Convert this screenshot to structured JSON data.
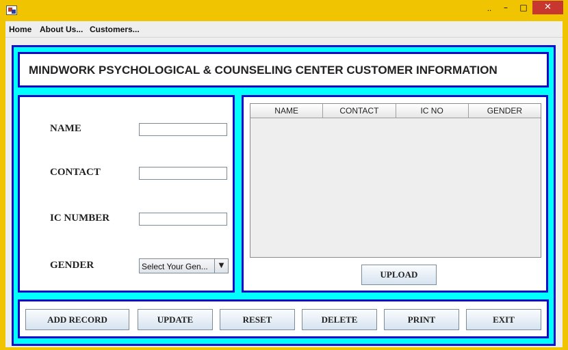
{
  "window": {
    "restore_glyph": "..",
    "minimize_glyph": "–",
    "maximize_glyph": "□",
    "close_glyph": "✕"
  },
  "menu": {
    "items": [
      {
        "label": "Home"
      },
      {
        "label": "About Us..."
      },
      {
        "label": "Customers..."
      }
    ]
  },
  "header": {
    "title": "MINDWORK PSYCHOLOGICAL & COUNSELING CENTER CUSTOMER INFORMATION"
  },
  "form": {
    "name_label": "NAME",
    "contact_label": "CONTACT",
    "ic_number_label": "IC NUMBER",
    "gender_label": "GENDER",
    "name_value": "",
    "contact_value": "",
    "ic_number_value": "",
    "gender_selected": "Select Your Gen..."
  },
  "table": {
    "columns": [
      "NAME",
      "CONTACT",
      "IC NO",
      "GENDER"
    ],
    "rows": [],
    "upload_label": "UPLOAD"
  },
  "actions": {
    "add_record": "ADD RECORD",
    "update": "UPDATE",
    "reset": "RESET",
    "delete": "DELETE",
    "print": "PRINT",
    "exit": "EXIT"
  },
  "colors": {
    "window_frame": "#f0c400",
    "panel_background": "#00ffff",
    "panel_border": "#0a0acd",
    "close_button": "#c7372f"
  },
  "icons": {
    "app": "java-app-icon",
    "gender_dropdown": "chevron-down-icon"
  }
}
